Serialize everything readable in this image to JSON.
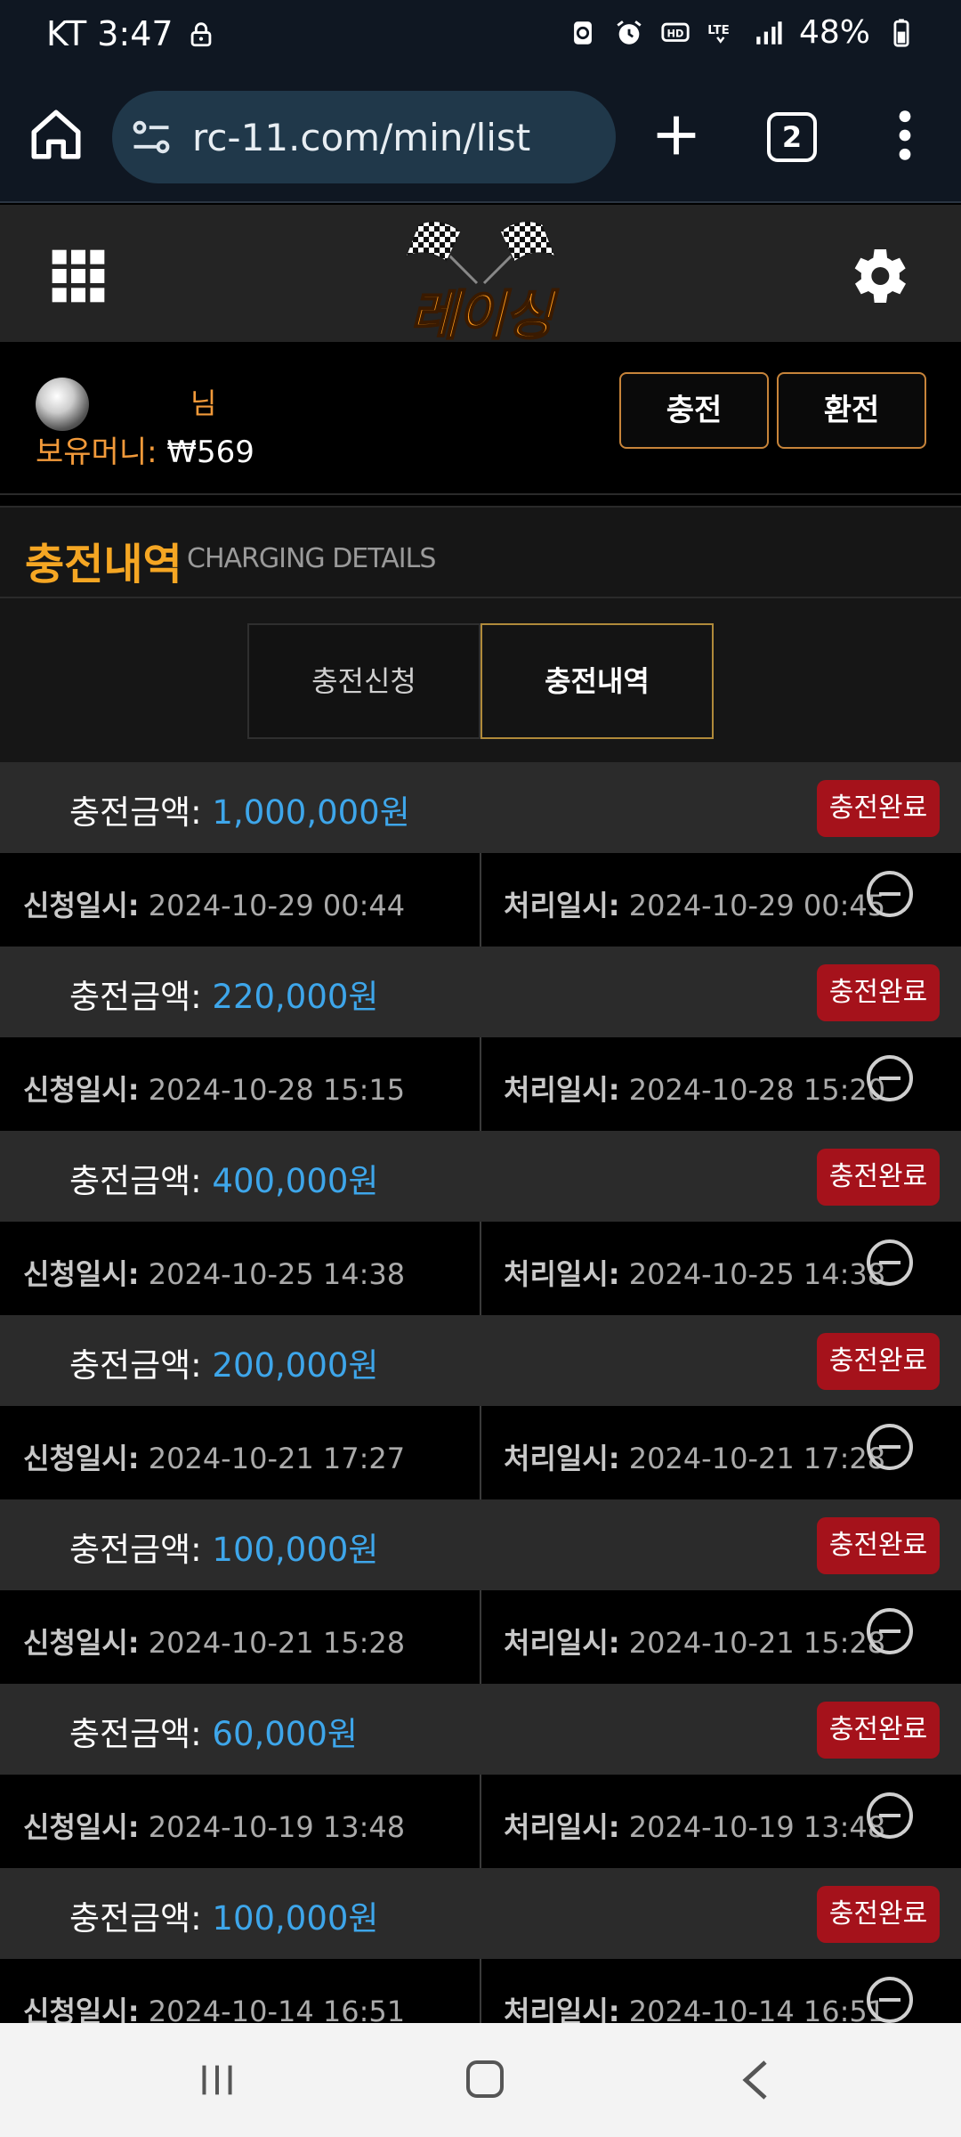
{
  "status_bar": {
    "carrier_time": "KT 3:47",
    "battery": "48%"
  },
  "browser": {
    "url": "rc-11.com/min/list",
    "tab_count": "2"
  },
  "app": {
    "logo_text": "레이싱"
  },
  "user": {
    "suffix": "님",
    "money_label": "보유머니:",
    "money_value": "₩569"
  },
  "buttons": {
    "charge": "충전",
    "exchange": "환전"
  },
  "section": {
    "title_ko": "충전내역",
    "title_en": "CHARGING DETAILS"
  },
  "tabs": {
    "apply": "충전신청",
    "history": "충전내역"
  },
  "labels": {
    "amount": "충전금액:",
    "requested": "신청일시:",
    "processed": "처리일시:",
    "status": "충전완료"
  },
  "records": [
    {
      "amount": "1,000,000원",
      "requested": "2024-10-29 00:44",
      "processed": "2024-10-29 00:45"
    },
    {
      "amount": "220,000원",
      "requested": "2024-10-28 15:15",
      "processed": "2024-10-28 15:20"
    },
    {
      "amount": "400,000원",
      "requested": "2024-10-25 14:38",
      "processed": "2024-10-25 14:38"
    },
    {
      "amount": "200,000원",
      "requested": "2024-10-21 17:27",
      "processed": "2024-10-21 17:28"
    },
    {
      "amount": "100,000원",
      "requested": "2024-10-21 15:28",
      "processed": "2024-10-21 15:28"
    },
    {
      "amount": "60,000원",
      "requested": "2024-10-19 13:48",
      "processed": "2024-10-19 13:48"
    },
    {
      "amount": "100,000원",
      "requested": "2024-10-14 16:51",
      "processed": "2024-10-14 16:51"
    }
  ],
  "colors": {
    "accent_orange": "#f5a623",
    "amount_blue": "#3ea6ea",
    "badge_red": "#a5121b"
  }
}
